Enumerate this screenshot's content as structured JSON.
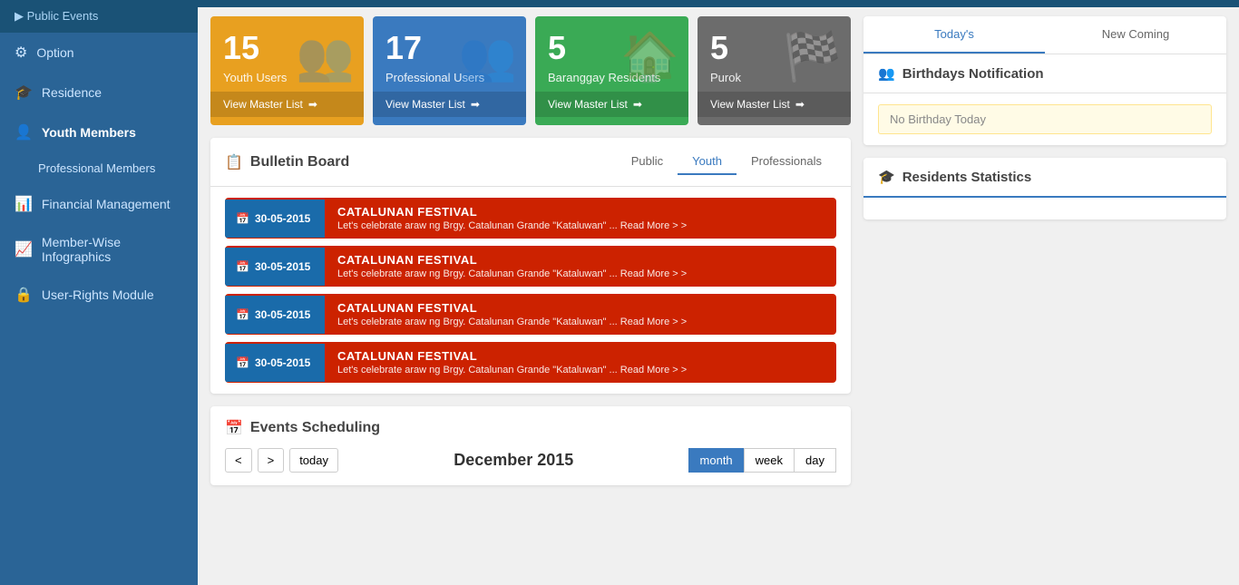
{
  "sidebar": {
    "top_item": "Public Events",
    "items": [
      {
        "id": "option",
        "label": "Option",
        "icon": "⚙"
      },
      {
        "id": "residence",
        "label": "Residence",
        "icon": "🎓"
      },
      {
        "id": "youth-members",
        "label": "Youth Members",
        "icon": "👤"
      },
      {
        "id": "professional-members",
        "label": "Professional Members",
        "icon": ""
      },
      {
        "id": "financial-management",
        "label": "Financial Management",
        "icon": "📊"
      },
      {
        "id": "member-wise",
        "label": "Member-Wise Infographics",
        "icon": "📈"
      },
      {
        "id": "user-rights",
        "label": "User-Rights Module",
        "icon": "🔒"
      }
    ]
  },
  "stats": [
    {
      "id": "youth-users",
      "number": "15",
      "label": "Youth Users",
      "footer": "View Master List",
      "color": "orange",
      "icon": "👥"
    },
    {
      "id": "professional-users",
      "number": "17",
      "label": "Professional Users",
      "footer": "View Master List",
      "color": "blue",
      "icon": "👥"
    },
    {
      "id": "baranggay-residents",
      "number": "5",
      "label": "Baranggay Residents",
      "footer": "View Master List",
      "color": "green",
      "icon": "🏠"
    },
    {
      "id": "purok",
      "number": "5",
      "label": "Purok",
      "footer": "View Master List",
      "color": "gray",
      "icon": "🏁"
    }
  ],
  "bulletin": {
    "title": "Bulletin Board",
    "tabs": [
      "Public",
      "Youth",
      "Professionals"
    ],
    "active_tab": "Youth",
    "items": [
      {
        "date": "30-05-2015",
        "title": "CATALUNAN FESTIVAL",
        "desc": "Let's celebrate araw ng Brgy. Catalunan Grande \"Kataluwan\" ... Read More > >"
      },
      {
        "date": "30-05-2015",
        "title": "CATALUNAN FESTIVAL",
        "desc": "Let's celebrate araw ng Brgy. Catalunan Grande \"Kataluwan\" ... Read More > >"
      },
      {
        "date": "30-05-2015",
        "title": "CATALUNAN FESTIVAL",
        "desc": "Let's celebrate araw ng Brgy. Catalunan Grande \"Kataluwan\" ... Read More > >"
      },
      {
        "date": "30-05-2015",
        "title": "CATALUNAN FESTIVAL",
        "desc": "Let's celebrate araw ng Brgy. Catalunan Grande \"Kataluwan\" ... Read More > >"
      }
    ]
  },
  "events": {
    "title": "Events Scheduling",
    "month": "December 2015",
    "nav": {
      "prev": "<",
      "next": ">",
      "today": "today"
    },
    "view_buttons": [
      "month",
      "week",
      "day"
    ],
    "active_view": "month"
  },
  "birthdays": {
    "title": "Birthdays Notification",
    "tabs": [
      "Today's",
      "New Coming"
    ],
    "active_tab": "Today's",
    "no_birthday_msg": "No Birthday Today"
  },
  "residents": {
    "title": "Residents Statistics"
  }
}
